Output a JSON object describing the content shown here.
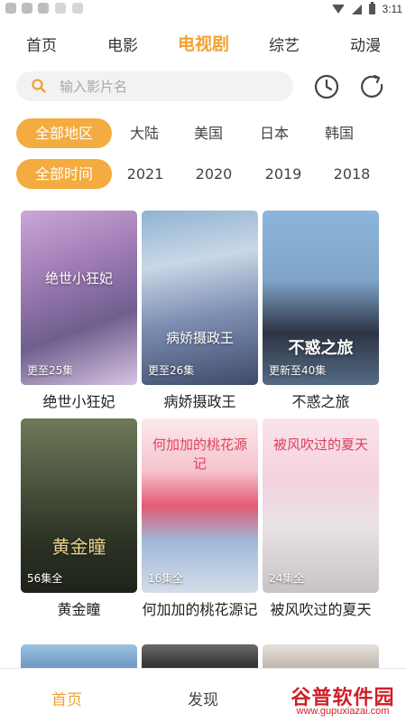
{
  "status_bar": {
    "time": "3:11"
  },
  "top_tabs": [
    "首页",
    "电影",
    "电视剧",
    "综艺",
    "动漫"
  ],
  "search": {
    "placeholder": "输入影片名"
  },
  "region_filters": [
    "全部地区",
    "大陆",
    "美国",
    "日本",
    "韩国"
  ],
  "year_filters": [
    "全部时间",
    "2021",
    "2020",
    "2019",
    "2018"
  ],
  "shows": [
    {
      "title": "绝世小狂妃",
      "badge": "更至25集",
      "poster_title": "绝世小狂妃"
    },
    {
      "title": "病娇摄政王",
      "badge": "更至26集",
      "poster_title": "病娇摄政王"
    },
    {
      "title": "不惑之旅",
      "badge": "更新至40集",
      "poster_title": "不惑之旅"
    },
    {
      "title": "黄金瞳",
      "badge": "56集全",
      "poster_title": "黄金瞳"
    },
    {
      "title": "何加加的桃花源记",
      "badge": "16集全",
      "poster_title": "何加加的桃花源记"
    },
    {
      "title": "被风吹过的夏天",
      "badge": "24集全",
      "poster_title": "被风吹过的夏天"
    }
  ],
  "bottom_nav": [
    "首页",
    "发现"
  ],
  "watermark": {
    "title": "谷普软件园",
    "url": "www.gupuxiazai.com"
  },
  "colors": {
    "accent": "#f3a132",
    "chip_active": "#f4ab3f",
    "watermark": "#d11f28"
  }
}
